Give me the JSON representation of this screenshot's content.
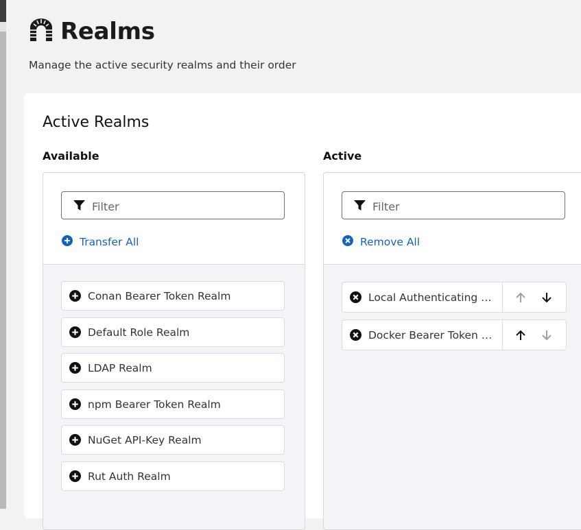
{
  "header": {
    "title": "Realms",
    "subtitle": "Manage the active security realms and their order",
    "icon": "castle-gate-icon"
  },
  "card": {
    "title": "Active Realms"
  },
  "available": {
    "label": "Available",
    "filter_placeholder": "Filter",
    "transfer_all_label": "Transfer All",
    "items": [
      {
        "label": "Conan Bearer Token Realm"
      },
      {
        "label": "Default Role Realm"
      },
      {
        "label": "LDAP Realm"
      },
      {
        "label": "npm Bearer Token Realm"
      },
      {
        "label": "NuGet API-Key Realm"
      },
      {
        "label": "Rut Auth Realm"
      }
    ]
  },
  "active": {
    "label": "Active",
    "filter_placeholder": "Filter",
    "remove_all_label": "Remove All",
    "items": [
      {
        "label": "Local Authenticating Realm",
        "move_up_enabled": false,
        "move_down_enabled": true
      },
      {
        "label": "Docker Bearer Token Realm",
        "move_up_enabled": true,
        "move_down_enabled": false
      }
    ]
  },
  "colors": {
    "link": "#1462c0",
    "disabled_arrow": "#a0a0a0",
    "panel_bg": "#f3f4f8"
  }
}
